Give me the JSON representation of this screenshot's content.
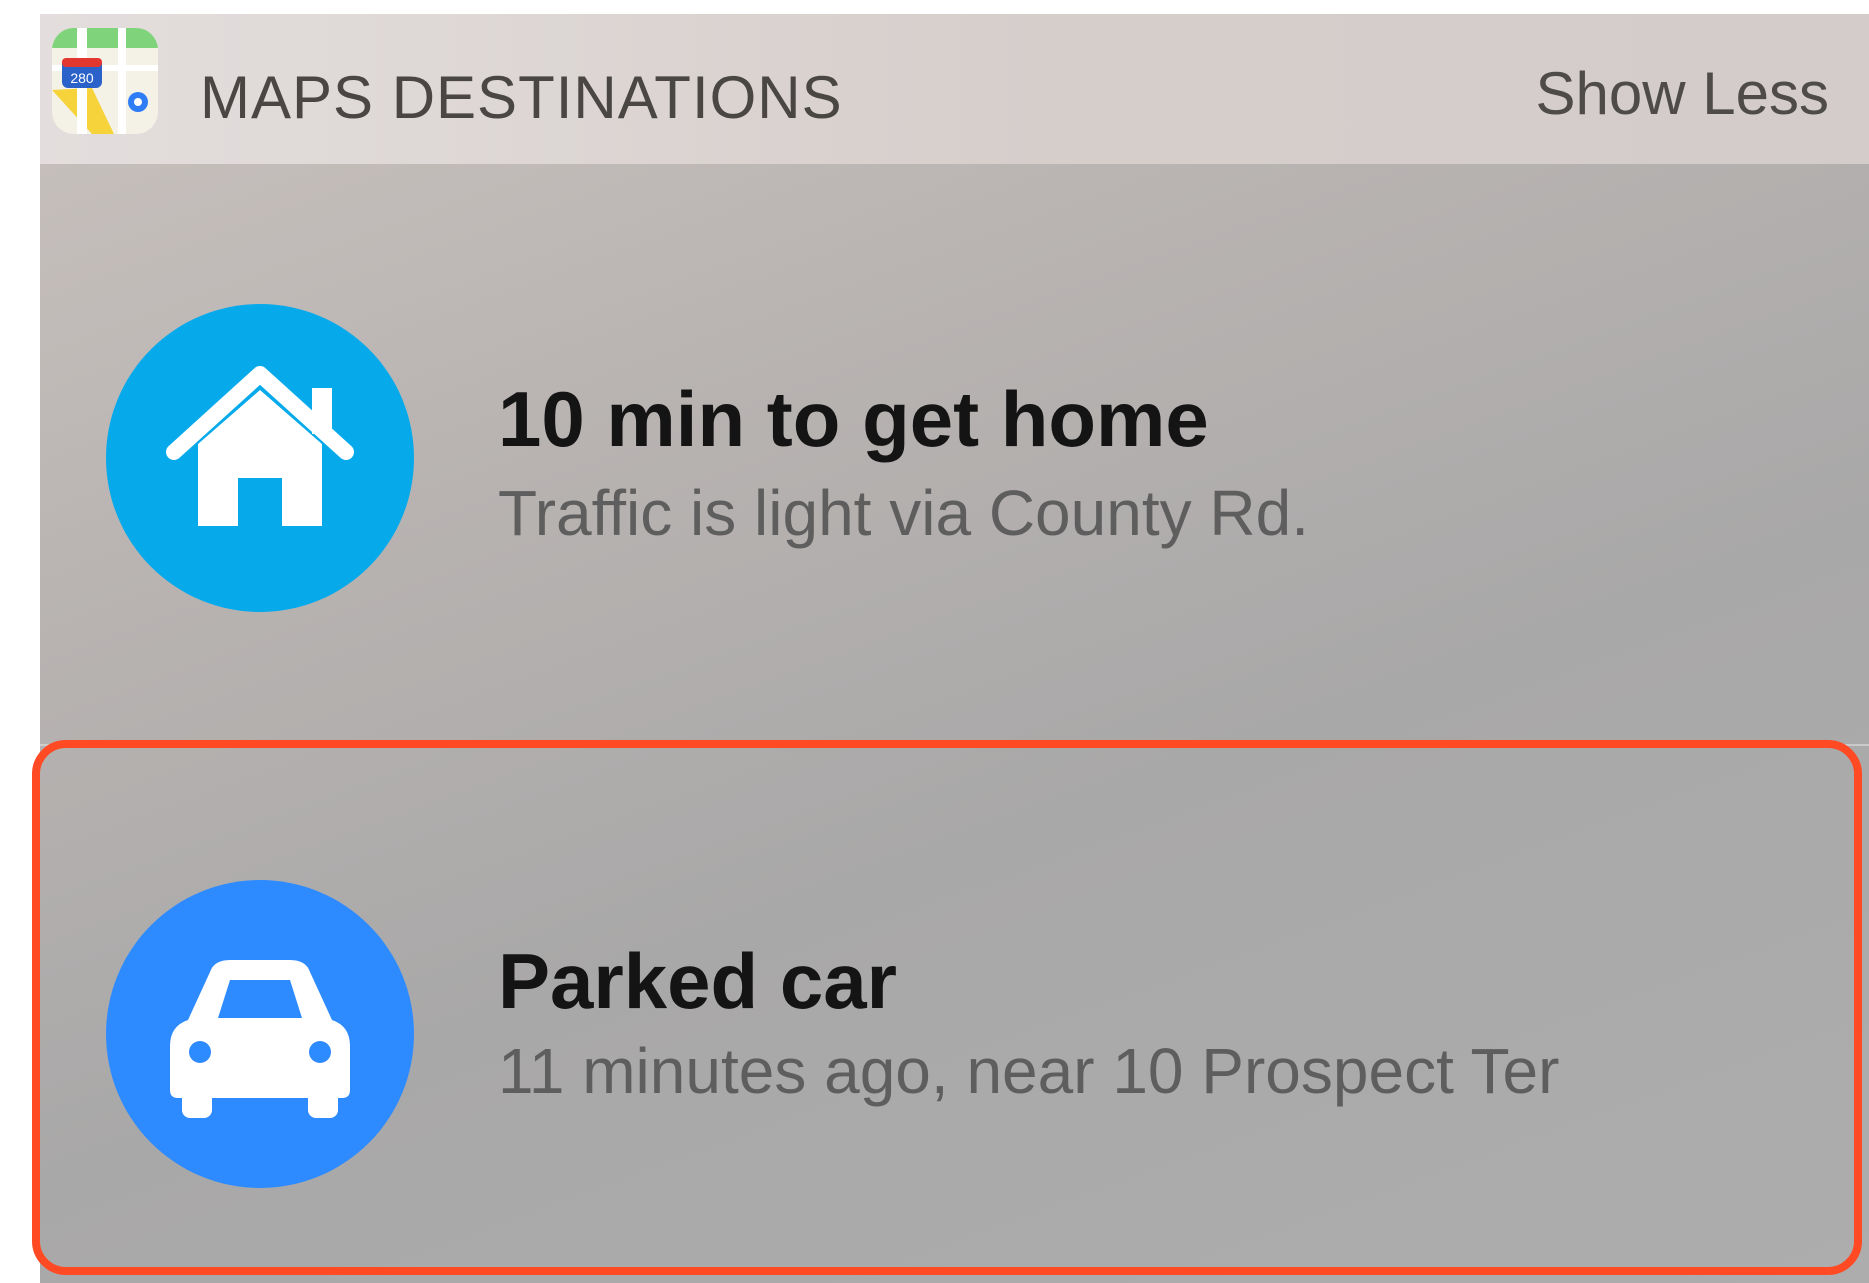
{
  "widget": {
    "title": "MAPS DESTINATIONS",
    "show_less_label": "Show Less",
    "app_icon": "apple-maps-icon",
    "app_icon_shield_text": "280"
  },
  "destinations": [
    {
      "icon": "house-icon",
      "icon_color": "#06aaeb",
      "title": "10 min to get home",
      "subtitle": "Traffic is light via County Rd."
    },
    {
      "icon": "car-icon",
      "icon_color": "#2e8bff",
      "title": "Parked car",
      "subtitle": "11 minutes ago, near 10 Prospect Ter"
    }
  ],
  "annotation": {
    "highlight_color": "#ff4a24"
  }
}
